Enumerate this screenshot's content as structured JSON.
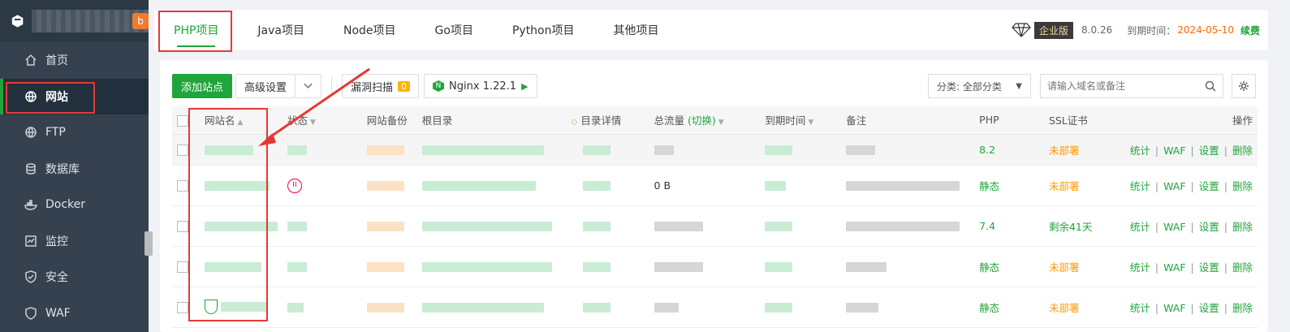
{
  "sidebar": {
    "logo_badge": "b",
    "items": [
      {
        "label": "首页",
        "icon": "home-icon"
      },
      {
        "label": "网站",
        "icon": "globe-icon"
      },
      {
        "label": "FTP",
        "icon": "ftp-globe-icon"
      },
      {
        "label": "数据库",
        "icon": "database-icon"
      },
      {
        "label": "Docker",
        "icon": "docker-icon"
      },
      {
        "label": "监控",
        "icon": "monitor-icon"
      },
      {
        "label": "安全",
        "icon": "shield-icon"
      },
      {
        "label": "WAF",
        "icon": "waf-icon"
      }
    ],
    "active_index": 1
  },
  "topbar": {
    "tabs": [
      "PHP项目",
      "Java项目",
      "Node项目",
      "Go项目",
      "Python项目",
      "其他项目"
    ],
    "active_tab": 0,
    "edition": "企业版",
    "version": "8.0.26",
    "expire_label": "到期时间：",
    "expire_date": "2024-05-10",
    "renew": "续费"
  },
  "toolbar": {
    "add_site": "添加站点",
    "advanced": "高级设置",
    "scan": "漏洞扫描",
    "scan_count": "0",
    "nginx": "Nginx 1.22.1",
    "category": "分类: 全部分类",
    "search_placeholder": "请输入域名或备注"
  },
  "table": {
    "headers": {
      "name": "网站名",
      "status": "状态",
      "backup": "网站备份",
      "root": "根目录",
      "dir_detail": "目录详情",
      "traffic": "总流量",
      "traffic_toggle": "(切换)",
      "expire": "到期时间",
      "remark": "备注",
      "php": "PHP",
      "ssl": "SSL证书",
      "ops": "操作"
    },
    "rows": [
      {
        "php": "8.2",
        "ssl": "未部署",
        "traffic": ""
      },
      {
        "php": "静态",
        "ssl": "未部署",
        "traffic": "0 B"
      },
      {
        "php": "7.4",
        "ssl": "剩余41天",
        "traffic": ""
      },
      {
        "php": "静态",
        "ssl": "未部署",
        "traffic": ""
      },
      {
        "php": "静态",
        "ssl": "未部署",
        "traffic": ""
      }
    ],
    "ops": [
      "统计",
      "WAF",
      "设置",
      "删除"
    ]
  },
  "colors": {
    "accent": "#20a53a",
    "warning": "#ff9900",
    "highlight": "#e53935"
  }
}
